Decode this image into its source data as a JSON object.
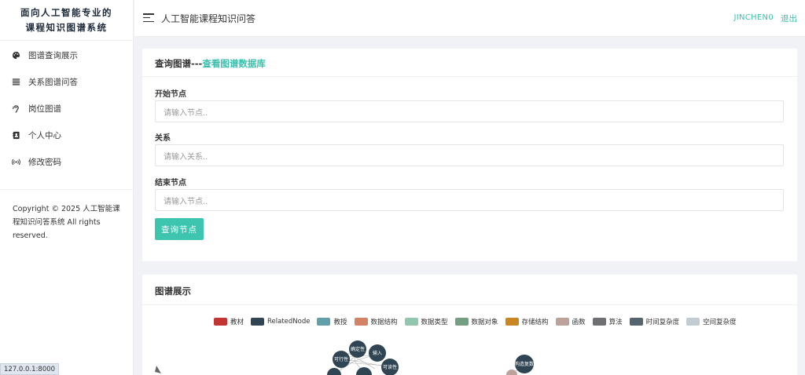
{
  "brand": {
    "line1": "面向人工智能专业的",
    "line2": "课程知识图谱系统"
  },
  "nav": [
    {
      "label": "图谱查询展示",
      "icon": "palette-icon"
    },
    {
      "label": "关系图谱问答",
      "icon": "list-icon"
    },
    {
      "label": "岗位图谱",
      "icon": "ear-icon"
    },
    {
      "label": "个人中心",
      "icon": "contact-book-icon"
    },
    {
      "label": "修改密码",
      "icon": "broadcast-icon"
    }
  ],
  "copyright": "Copyright © 2025 人工智能课程知识问答系统 All rights reserved.",
  "header": {
    "title": "人工智能课程知识问答",
    "user": "JINCHEN0",
    "logout": "退出"
  },
  "query_card": {
    "title": "查询图谱---",
    "link": "查看图谱数据库",
    "start_label": "开始节点",
    "start_placeholder": "请输入节点..",
    "relation_label": "关系",
    "relation_placeholder": "请输入关系..",
    "end_label": "结束节点",
    "end_placeholder": "请输入节点..",
    "submit": "查询节点"
  },
  "graph_card": {
    "title": "图谱展示",
    "legend": [
      {
        "label": "教材",
        "color": "#c23531"
      },
      {
        "label": "RelatedNode",
        "color": "#2f4554"
      },
      {
        "label": "教授",
        "color": "#61a0a8"
      },
      {
        "label": "数据结构",
        "color": "#d48265"
      },
      {
        "label": "数据类型",
        "color": "#91c7ae"
      },
      {
        "label": "数据对象",
        "color": "#749f83"
      },
      {
        "label": "存储结构",
        "color": "#ca8622"
      },
      {
        "label": "函数",
        "color": "#bda29a"
      },
      {
        "label": "算法",
        "color": "#6e7074"
      },
      {
        "label": "时间复杂度",
        "color": "#546570"
      },
      {
        "label": "空间复杂度",
        "color": "#c4ccd3"
      }
    ],
    "nodes": [
      "可行性",
      "确定性",
      "输入",
      "可读性",
      "构造复数"
    ]
  },
  "status_url": "127.0.0.1:8000"
}
